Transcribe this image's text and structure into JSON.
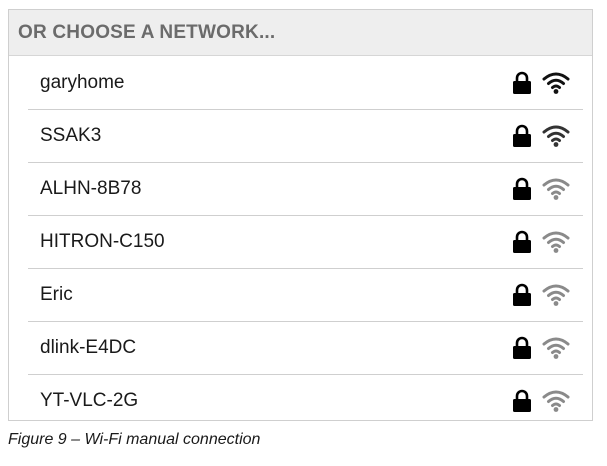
{
  "header": {
    "title": "OR CHOOSE A NETWORK..."
  },
  "networks": [
    {
      "name": "garyhome",
      "secured": true,
      "signal": "strong",
      "wifi_color": "#111111"
    },
    {
      "name": "SSAK3",
      "secured": true,
      "signal": "medium",
      "wifi_color": "#333333"
    },
    {
      "name": "ALHN-8B78",
      "secured": true,
      "signal": "weak",
      "wifi_color": "#8a8a8a"
    },
    {
      "name": "HITRON-C150",
      "secured": true,
      "signal": "weak",
      "wifi_color": "#8a8a8a"
    },
    {
      "name": "Eric",
      "secured": true,
      "signal": "weak",
      "wifi_color": "#8a8a8a"
    },
    {
      "name": "dlink-E4DC",
      "secured": true,
      "signal": "weak",
      "wifi_color": "#8a8a8a"
    },
    {
      "name": "YT-VLC-2G",
      "secured": true,
      "signal": "weak",
      "wifi_color": "#8a8a8a"
    }
  ],
  "icons": {
    "lock": "lock-icon",
    "wifi": "wifi-icon"
  },
  "caption": "Figure 9 – Wi-Fi manual connection"
}
